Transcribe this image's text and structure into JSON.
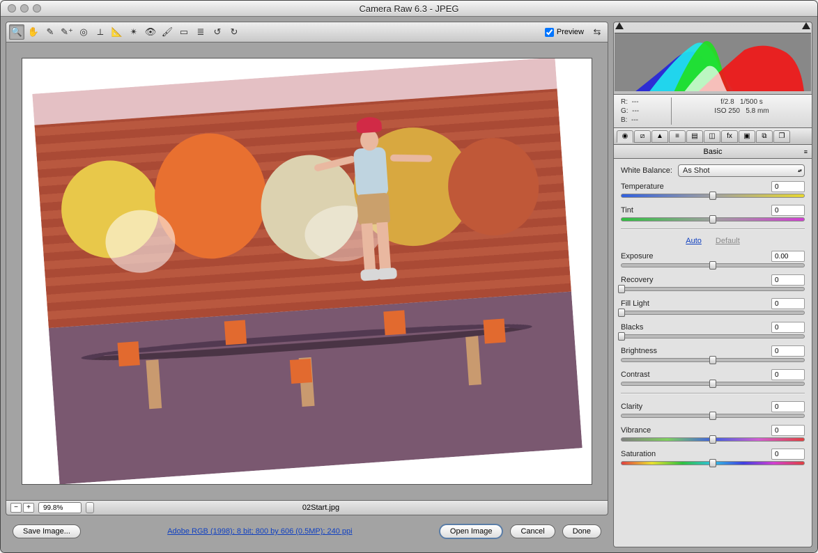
{
  "window": {
    "title": "Camera Raw 6.3  -  JPEG"
  },
  "toolbar": {
    "tools": [
      {
        "name": "zoom-tool",
        "glyph": "🔍"
      },
      {
        "name": "hand-tool",
        "glyph": "✋"
      },
      {
        "name": "white-balance-tool",
        "glyph": "✎"
      },
      {
        "name": "color-sampler-tool",
        "glyph": "✎⁺"
      },
      {
        "name": "targeted-adjustment-tool",
        "glyph": "◎"
      },
      {
        "name": "crop-tool",
        "glyph": "⟂"
      },
      {
        "name": "straighten-tool",
        "glyph": "📐"
      },
      {
        "name": "spot-removal-tool",
        "glyph": "✴"
      },
      {
        "name": "red-eye-removal-tool",
        "glyph": "👁"
      },
      {
        "name": "adjustment-brush-tool",
        "glyph": "🖌"
      },
      {
        "name": "graduated-filter-tool",
        "glyph": "▭"
      },
      {
        "name": "preferences-tool",
        "glyph": "≣"
      },
      {
        "name": "rotate-ccw-tool",
        "glyph": "↺"
      },
      {
        "name": "rotate-cw-tool",
        "glyph": "↻"
      }
    ],
    "preview_label": "Preview",
    "fullscreen_glyph": "⇆"
  },
  "status": {
    "zoom_minus": "−",
    "zoom_plus": "+",
    "zoom_value": "99.8%",
    "filename": "02Start.jpg"
  },
  "footer": {
    "save_image": "Save Image...",
    "workflow": "Adobe RGB (1998); 8 bit; 800 by 606 (0.5MP); 240 ppi",
    "open_image": "Open Image",
    "cancel": "Cancel",
    "done": "Done"
  },
  "meta": {
    "r": "R:",
    "r_val": "---",
    "g": "G:",
    "g_val": "---",
    "b": "B:",
    "b_val": "---",
    "aperture": "f/2.8",
    "shutter": "1/500 s",
    "iso": "ISO 250",
    "focal": "5.8 mm"
  },
  "tabs": {
    "items": [
      {
        "name": "tab-basic",
        "glyph": "◉"
      },
      {
        "name": "tab-tone-curve",
        "glyph": "⧄"
      },
      {
        "name": "tab-detail",
        "glyph": "▲"
      },
      {
        "name": "tab-hsl",
        "glyph": "≡"
      },
      {
        "name": "tab-split-toning",
        "glyph": "▤"
      },
      {
        "name": "tab-lens",
        "glyph": "◫"
      },
      {
        "name": "tab-effects",
        "glyph": "fx"
      },
      {
        "name": "tab-calibration",
        "glyph": "▣"
      },
      {
        "name": "tab-presets",
        "glyph": "⧉"
      },
      {
        "name": "tab-snapshots",
        "glyph": "❐"
      }
    ]
  },
  "panel": {
    "title": "Basic",
    "wb_label": "White Balance:",
    "wb_value": "As Shot",
    "auto": "Auto",
    "default": "Default",
    "sliders": {
      "temperature": {
        "label": "Temperature",
        "value": "0",
        "pos": 50,
        "track": "temp"
      },
      "tint": {
        "label": "Tint",
        "value": "0",
        "pos": 50,
        "track": "tint"
      },
      "exposure": {
        "label": "Exposure",
        "value": "0.00",
        "pos": 50,
        "track": "plain"
      },
      "recovery": {
        "label": "Recovery",
        "value": "0",
        "pos": 0,
        "track": "plain"
      },
      "fill": {
        "label": "Fill Light",
        "value": "0",
        "pos": 0,
        "track": "plain"
      },
      "blacks": {
        "label": "Blacks",
        "value": "0",
        "pos": 0,
        "track": "plain"
      },
      "brightness": {
        "label": "Brightness",
        "value": "0",
        "pos": 50,
        "track": "plain"
      },
      "contrast": {
        "label": "Contrast",
        "value": "0",
        "pos": 50,
        "track": "plain"
      },
      "clarity": {
        "label": "Clarity",
        "value": "0",
        "pos": 50,
        "track": "plain"
      },
      "vibrance": {
        "label": "Vibrance",
        "value": "0",
        "pos": 50,
        "track": "vib"
      },
      "saturation": {
        "label": "Saturation",
        "value": "0",
        "pos": 50,
        "track": "sat"
      }
    }
  }
}
